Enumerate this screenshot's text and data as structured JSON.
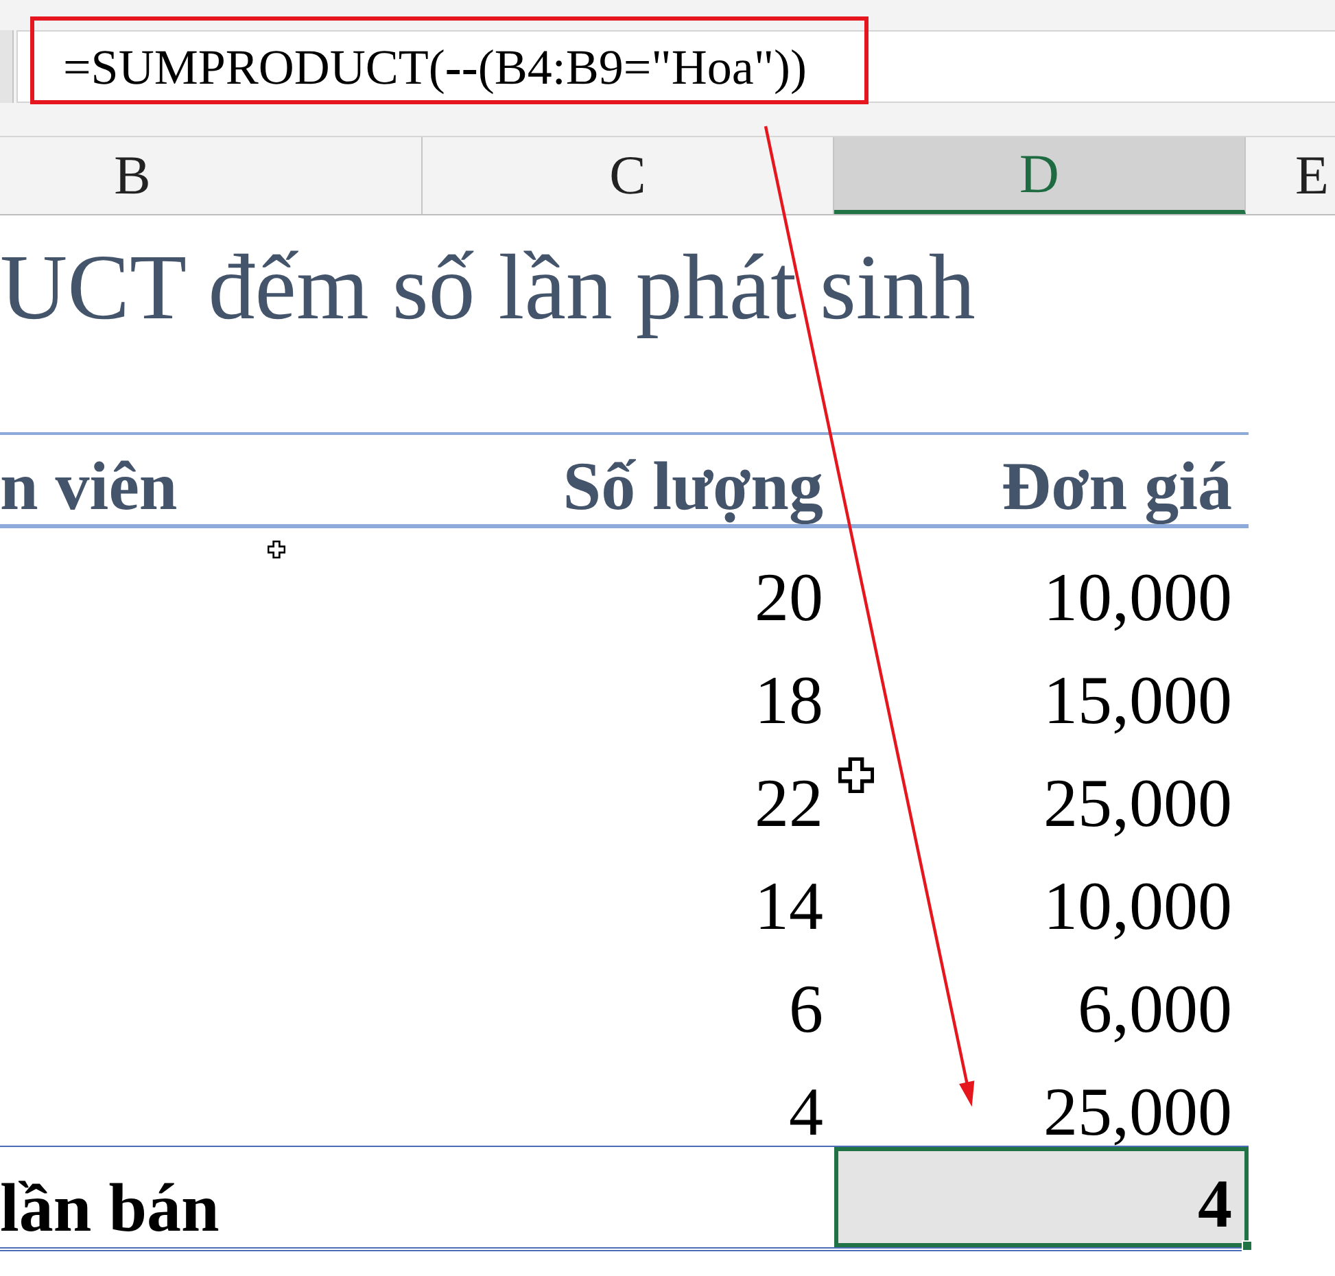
{
  "formula_bar": {
    "formula": "=SUMPRODUCT(**--**(B4:B9=\"Hoa\"))",
    "highlighted": true
  },
  "column_headers": [
    {
      "label": "B",
      "selected": false
    },
    {
      "label": "C",
      "selected": false
    },
    {
      "label": "D",
      "selected": true
    },
    {
      "label": "E",
      "selected": false
    }
  ],
  "sheet": {
    "title": "UCT đếm số lần phát sinh",
    "table": {
      "columns": [
        "n viên",
        "Số lượng",
        "Đơn giá"
      ],
      "rows": [
        [
          "",
          "20",
          "10,000"
        ],
        [
          "",
          "18",
          "15,000"
        ],
        [
          "",
          "22",
          "25,000"
        ],
        [
          "",
          "14",
          "10,000"
        ],
        [
          "",
          "6",
          "6,000"
        ],
        [
          "",
          "4",
          "25,000"
        ]
      ],
      "total": {
        "label": "lần bán",
        "value": "4",
        "selected": true
      }
    }
  }
}
